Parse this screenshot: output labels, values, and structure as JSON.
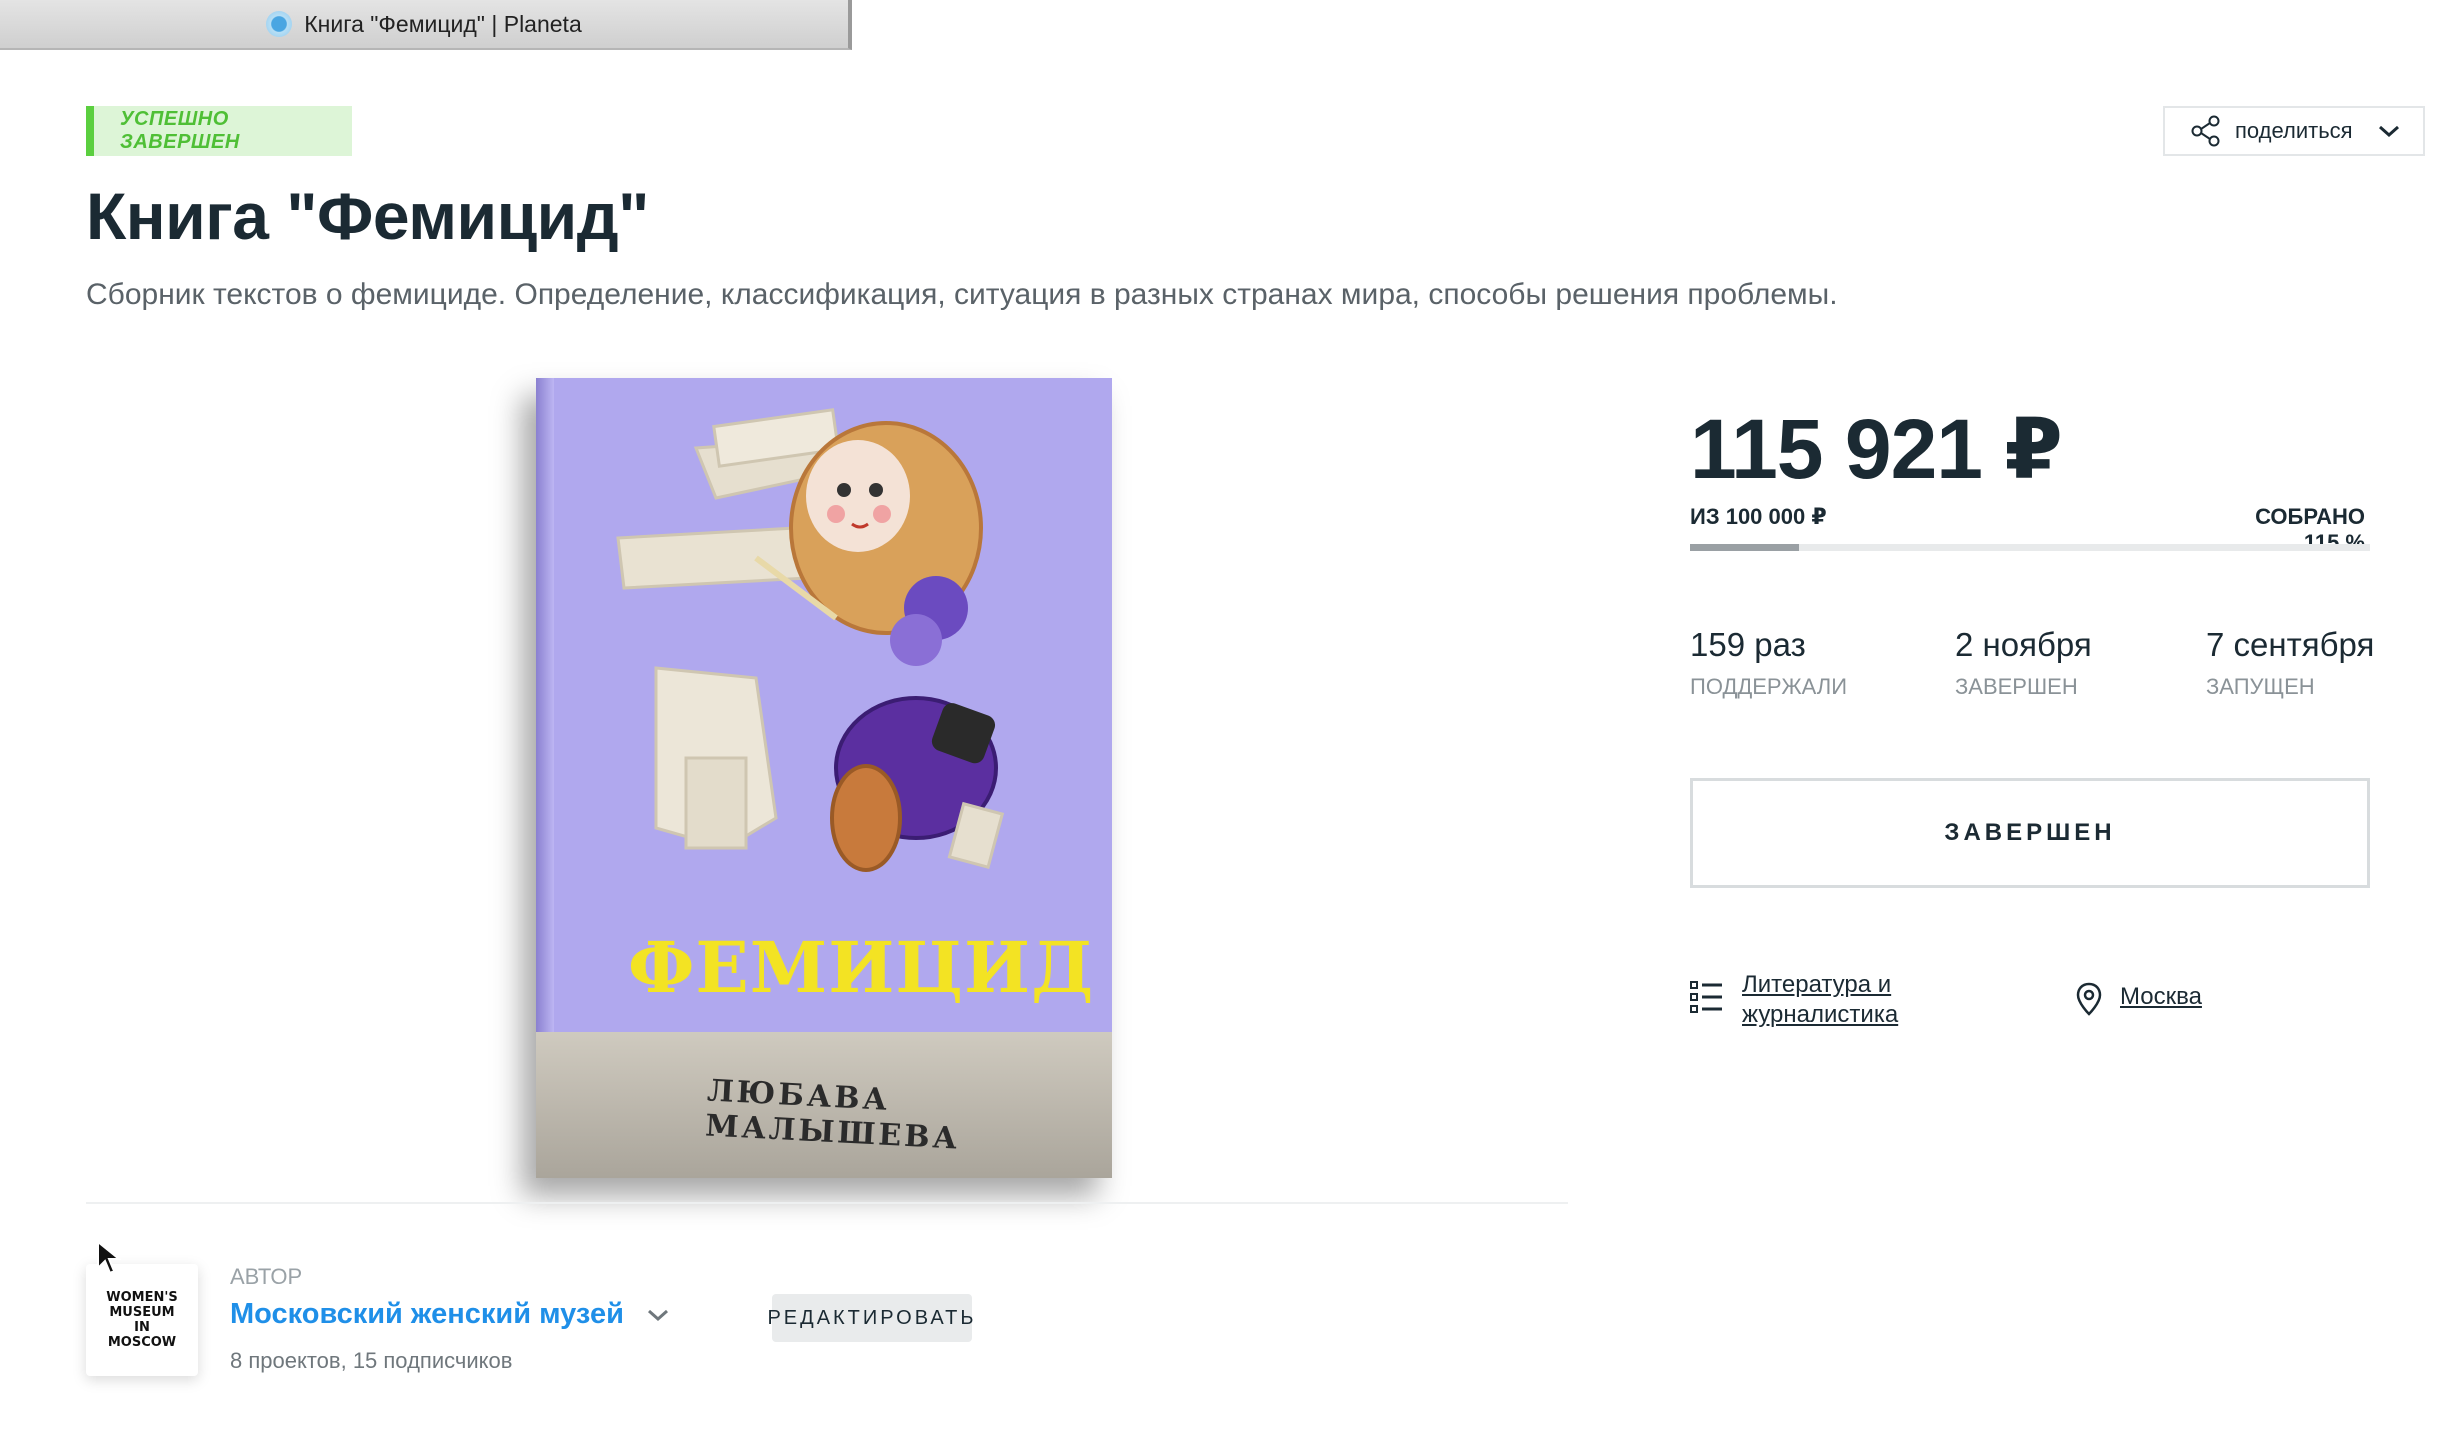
{
  "browser": {
    "tab_title": "Книга \"Фемицид\" | Planeta"
  },
  "project": {
    "status_badge": "УСПЕШНО ЗАВЕРШЕН",
    "title": "Книга \"Фемицид\"",
    "description": "Сборник текстов о фемициде. Определение, классификация, ситуация в разных странах мира, способы решения проблемы."
  },
  "share": {
    "label": "поделиться"
  },
  "cover": {
    "book_title": "ФЕМИЦИД",
    "book_author": "ЛЮБАВА МАЛЫШЕВА"
  },
  "funding": {
    "amount": "115 921 ₽",
    "goal": "ИЗ 100 000 ₽",
    "collected": "СОБРАНО 115 %",
    "progress_fraction": 0.16
  },
  "stats": [
    {
      "value": "159 раз",
      "label": "ПОДДЕРЖАЛИ"
    },
    {
      "value": "2 ноября",
      "label": "ЗАВЕРШЕН"
    },
    {
      "value": "7 сентября",
      "label": "ЗАПУЩЕН"
    }
  ],
  "action_button": "ЗАВЕРШЕН",
  "category": {
    "line1": "Литература и",
    "line2": "журналистика"
  },
  "location": "Москва",
  "author": {
    "caption": "АВТОР",
    "name": "Московский женский музей",
    "meta": "8 проектов, 15 подписчиков",
    "avatar_text": [
      "WOMEN'S",
      "MUSEUM",
      "IN",
      "MOSCOW"
    ],
    "edit_button": "РЕДАКТИРОВАТЬ"
  },
  "colors": {
    "accent_green": "#5bcf3f",
    "badge_bg": "#ddf5d7",
    "link_blue": "#1f8fe8",
    "text_dark": "#1b2a33",
    "cover_lilac": "#b0a8ee",
    "cover_title_yellow": "#f3e323"
  }
}
